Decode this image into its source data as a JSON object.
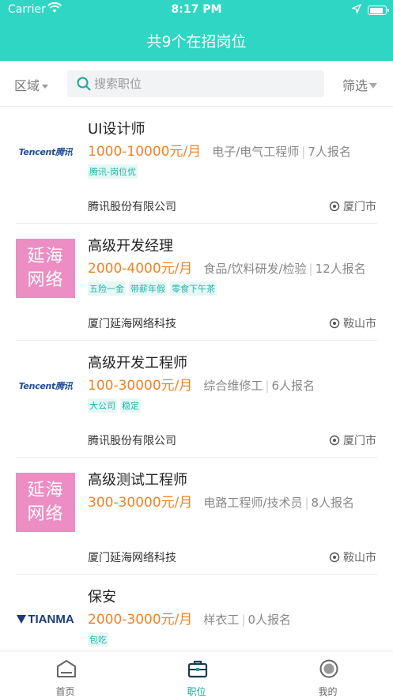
{
  "status": {
    "carrier": "Carrier",
    "time": "8:17 PM",
    "battery_level": 0.92
  },
  "nav": {
    "title": "共9个在招岗位"
  },
  "filter": {
    "area_label": "区域",
    "search_placeholder": "搜索职位",
    "filter_label": "筛选"
  },
  "jobs": [
    {
      "logo": "tencent",
      "logo_text": "Tencent腾讯",
      "title": "UI设计师",
      "salary": "1000-10000元/月",
      "category": "电子/电气工程师",
      "applicants": "7人报名",
      "tags": [
        "腾讯-岗位优"
      ],
      "company": "腾讯股份有限公司",
      "city": "厦门市"
    },
    {
      "logo": "yanhai",
      "logo_line1": "延海",
      "logo_line2": "网络",
      "title": "高级开发经理",
      "salary": "2000-4000元/月",
      "category": "食品/饮料研发/检验",
      "applicants": "12人报名",
      "tags": [
        "五险一金",
        "带薪年假",
        "零食下午茶"
      ],
      "company": "厦门延海网络科技",
      "city": "鞍山市"
    },
    {
      "logo": "tencent",
      "logo_text": "Tencent腾讯",
      "title": "高级开发工程师",
      "salary": "100-30000元/月",
      "category": "综合维修工",
      "applicants": "6人报名",
      "tags": [
        "大公司",
        "稳定"
      ],
      "company": "腾讯股份有限公司",
      "city": "厦门市"
    },
    {
      "logo": "yanhai",
      "logo_line1": "延海",
      "logo_line2": "网络",
      "title": "高级测试工程师",
      "salary": "300-30000元/月",
      "category": "电路工程师/技术员",
      "applicants": "8人报名",
      "tags": [],
      "company": "厦门延海网络科技",
      "city": "鞍山市"
    },
    {
      "logo": "tianma",
      "logo_text": "TIANMA",
      "title": "保安",
      "salary": "2000-3000元/月",
      "category": "样衣工",
      "applicants": "0人报名",
      "tags": [
        "包吃"
      ],
      "company": "",
      "city": ""
    }
  ],
  "tabs": [
    {
      "label": "首页",
      "icon": "home-icon",
      "active": false
    },
    {
      "label": "职位",
      "icon": "briefcase-icon",
      "active": true
    },
    {
      "label": "我的",
      "icon": "profile-icon",
      "active": false
    }
  ],
  "colors": {
    "accent": "#2ed6c3",
    "salary": "#f08324",
    "tag_text": "#1cb6a8",
    "yanhai_logo": "#ec8dc4"
  }
}
